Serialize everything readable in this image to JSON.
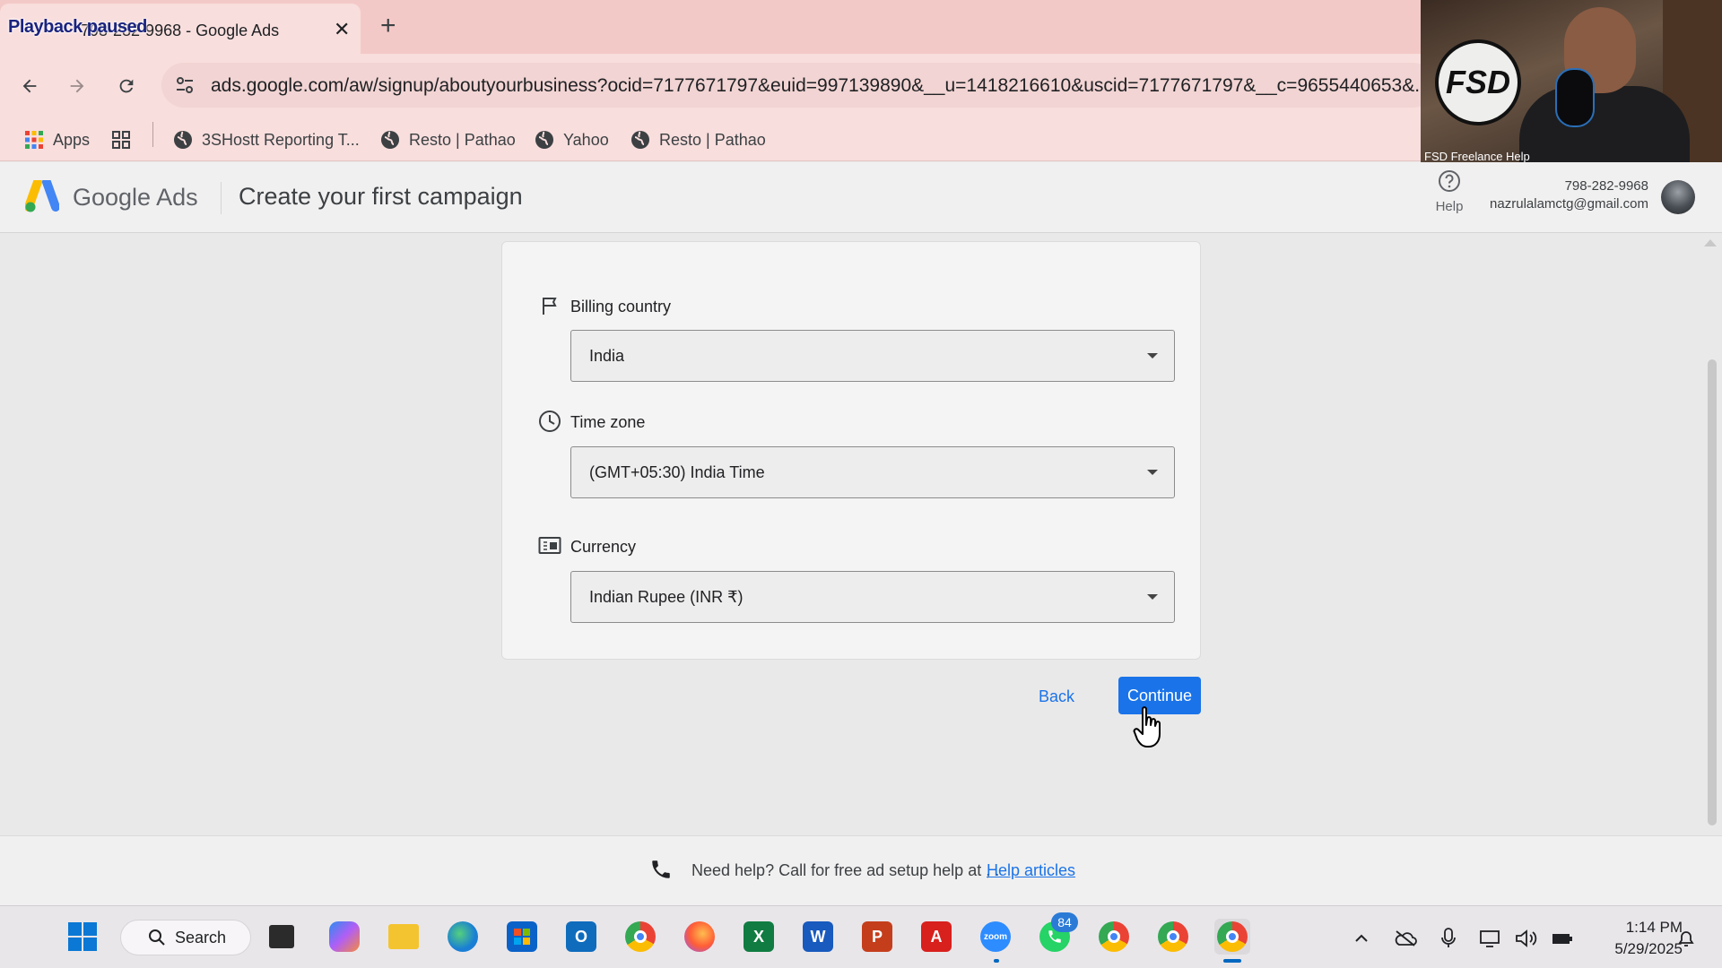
{
  "browser": {
    "tab_title": "798-282-9968 - Google Ads",
    "playback_overlay": "Playback paused",
    "url": "ads.google.com/aw/signup/aboutyourbusiness?ocid=7177671797&euid=997139890&__u=1418216610&uscid=7177671797&__c=9655440653&...",
    "bookmarks": [
      {
        "label": "Apps",
        "icon": "apps-grid-icon"
      },
      {
        "label": "",
        "icon": "tab-groups-icon"
      },
      {
        "label": "3SHostt Reporting T...",
        "icon": "globe-icon"
      },
      {
        "label": "Resto | Pathao",
        "icon": "globe-icon"
      },
      {
        "label": "Yahoo",
        "icon": "globe-icon"
      },
      {
        "label": "Resto | Pathao",
        "icon": "globe-icon"
      }
    ]
  },
  "webcam": {
    "logo_text": "FSD",
    "caption": "FSD Freelance Help"
  },
  "header": {
    "product_name": "Google Ads",
    "page_title": "Create your first campaign",
    "help_label": "Help",
    "account_phone": "798-282-9968",
    "account_email": "nazrulalamctg@gmail.com"
  },
  "form": {
    "fields": [
      {
        "label": "Billing country",
        "value": "India",
        "icon": "flag-icon"
      },
      {
        "label": "Time zone",
        "value": "(GMT+05:30) India Time",
        "icon": "clock-icon"
      },
      {
        "label": "Currency",
        "value": "Indian Rupee (INR ₹)",
        "icon": "currency-icon"
      }
    ],
    "back_label": "Back",
    "continue_label": "Continue"
  },
  "footer": {
    "text": "Need help? Call for free ad setup help at , .",
    "link": "Help articles"
  },
  "taskbar": {
    "search_label": "Search",
    "whatsapp_badge": "84",
    "time": "1:14 PM",
    "date": "5/29/2025"
  },
  "colors": {
    "accent": "#1a73e8",
    "tab_strip": "#f3c9c7",
    "toolbar": "#f8dedd"
  }
}
